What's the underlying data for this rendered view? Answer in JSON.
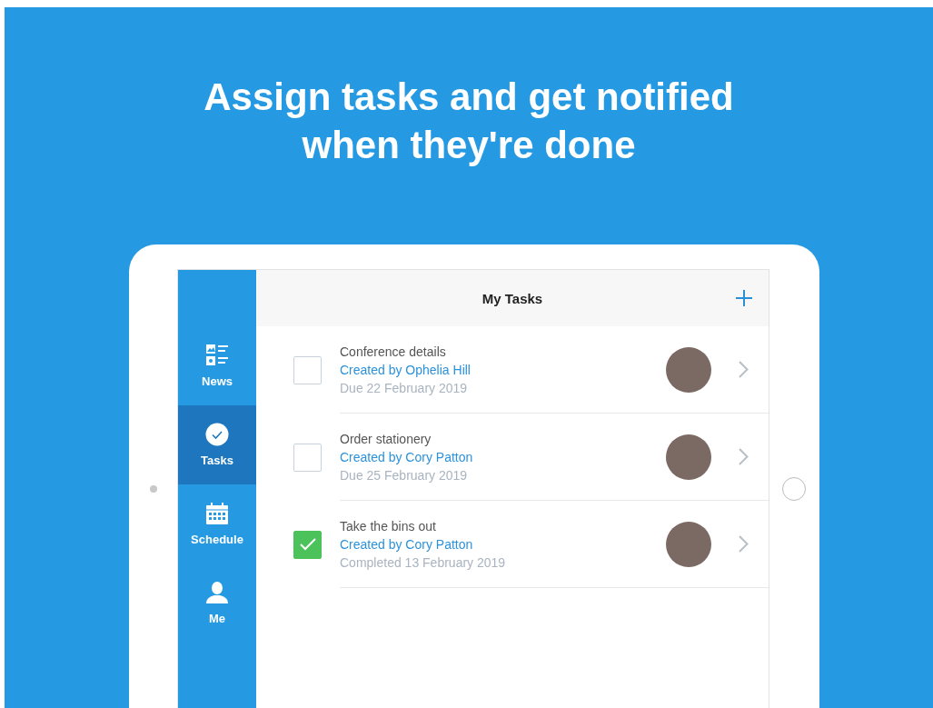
{
  "headline": "Assign tasks and get notified when they're done",
  "sidebar": {
    "items": [
      {
        "label": "News",
        "selected": false
      },
      {
        "label": "Tasks",
        "selected": true
      },
      {
        "label": "Schedule",
        "selected": false
      },
      {
        "label": "Me",
        "selected": false
      }
    ]
  },
  "header": {
    "title": "My Tasks"
  },
  "tasks": [
    {
      "title": "Conference details",
      "creator": "Created by Ophelia Hill",
      "date": "Due 22 February 2019",
      "checked": false
    },
    {
      "title": "Order stationery",
      "creator": "Created by Cory Patton",
      "date": "Due 25 February 2019",
      "checked": false
    },
    {
      "title": "Take the bins out",
      "creator": "Created by Cory Patton",
      "date": "Completed 13 February 2019",
      "checked": true
    }
  ]
}
